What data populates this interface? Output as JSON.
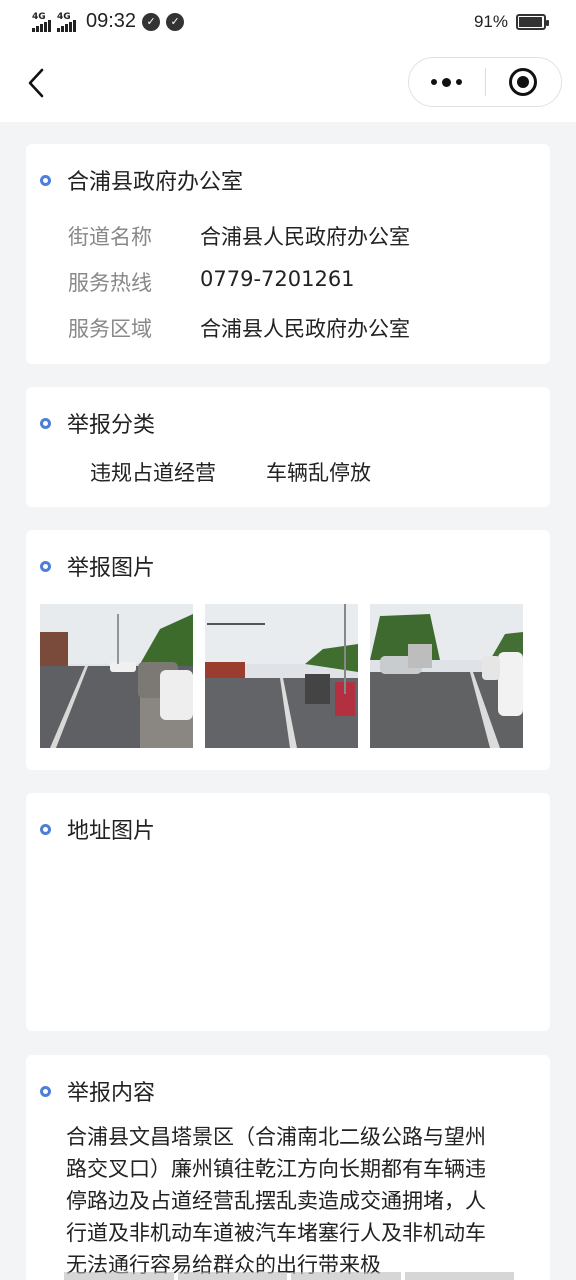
{
  "status_bar": {
    "signal_1": "4G",
    "signal_2": "4G",
    "time": "09:32",
    "battery": "91%"
  },
  "nav": {
    "back_icon": "chevron-left-icon",
    "more_icon": "more-dots-icon",
    "close_icon": "target-circle-icon"
  },
  "office_card": {
    "title": "合浦县政府办公室",
    "rows": [
      {
        "key": "街道名称",
        "value": "合浦县人民政府办公室"
      },
      {
        "key": "服务热线",
        "value": "0779-7201261"
      },
      {
        "key": "服务区域",
        "value": "合浦县人民政府办公室"
      }
    ]
  },
  "category_card": {
    "title": "举报分类",
    "tags": [
      "违规占道经营",
      "车辆乱停放"
    ]
  },
  "photos_card": {
    "title": "举报图片"
  },
  "address_card": {
    "title": "地址图片"
  },
  "content_card": {
    "title": "举报内容",
    "text": "合浦县文昌塔景区（合浦南北二级公路与望州路交叉口）廉州镇往乾江方向长期都有车辆违停路边及占道经营乱摆乱卖造成交通拥堵，人行道及非机动车道被汽车堵塞行人及非机动车无法通行容易给群众的出行带来极"
  },
  "colors": {
    "accent": "#4e7fd8",
    "background": "#f3f4f6"
  }
}
